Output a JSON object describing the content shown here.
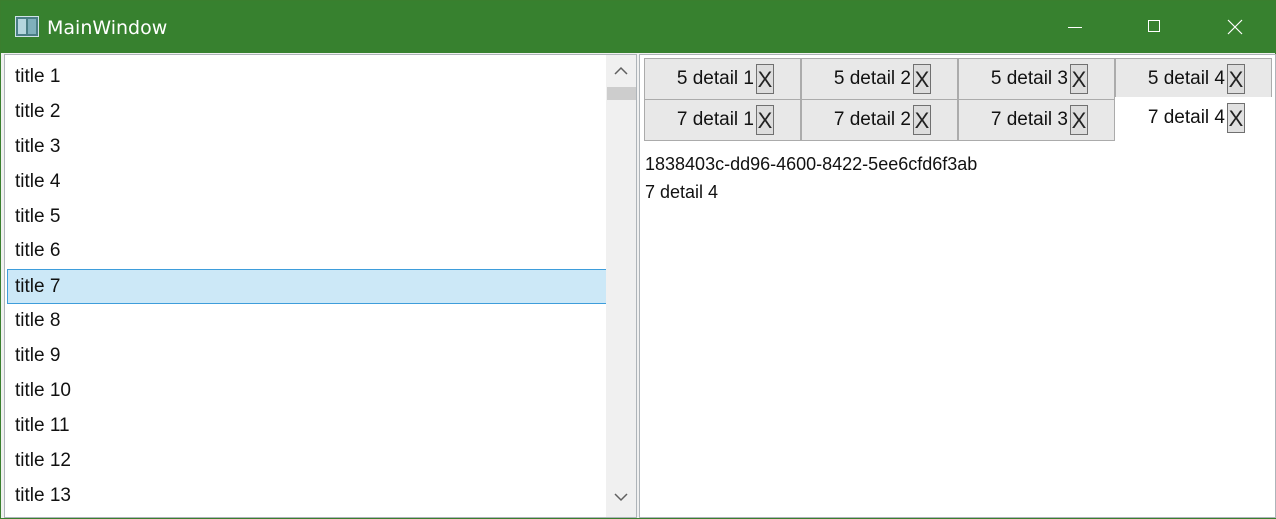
{
  "window": {
    "title": "MainWindow",
    "titlebar_color": "#37812f",
    "buttons": {
      "minimize": "minimize-icon",
      "maximize": "maximize-icon",
      "close": "close-icon"
    }
  },
  "list": {
    "items": [
      "title 1",
      "title 2",
      "title 3",
      "title 4",
      "title 5",
      "title 6",
      "title 7",
      "title 8",
      "title 9",
      "title 10",
      "title 11",
      "title 12",
      "title 13"
    ],
    "selected_index": 6,
    "selection_color": "#cce8f7"
  },
  "tabs": {
    "row1": [
      {
        "label": "5 detail 1",
        "close": "X"
      },
      {
        "label": "5 detail 2",
        "close": "X"
      },
      {
        "label": "5 detail 3",
        "close": "X"
      },
      {
        "label": "5 detail 4",
        "close": "X"
      }
    ],
    "row2": [
      {
        "label": "7 detail 1",
        "close": "X"
      },
      {
        "label": "7 detail 2",
        "close": "X"
      },
      {
        "label": "7 detail 3",
        "close": "X"
      },
      {
        "label": "7 detail 4",
        "close": "X"
      }
    ],
    "active": "7 detail 4"
  },
  "content": {
    "id": "1838403c-dd96-4600-8422-5ee6cfd6f3ab",
    "name": "7 detail 4"
  }
}
